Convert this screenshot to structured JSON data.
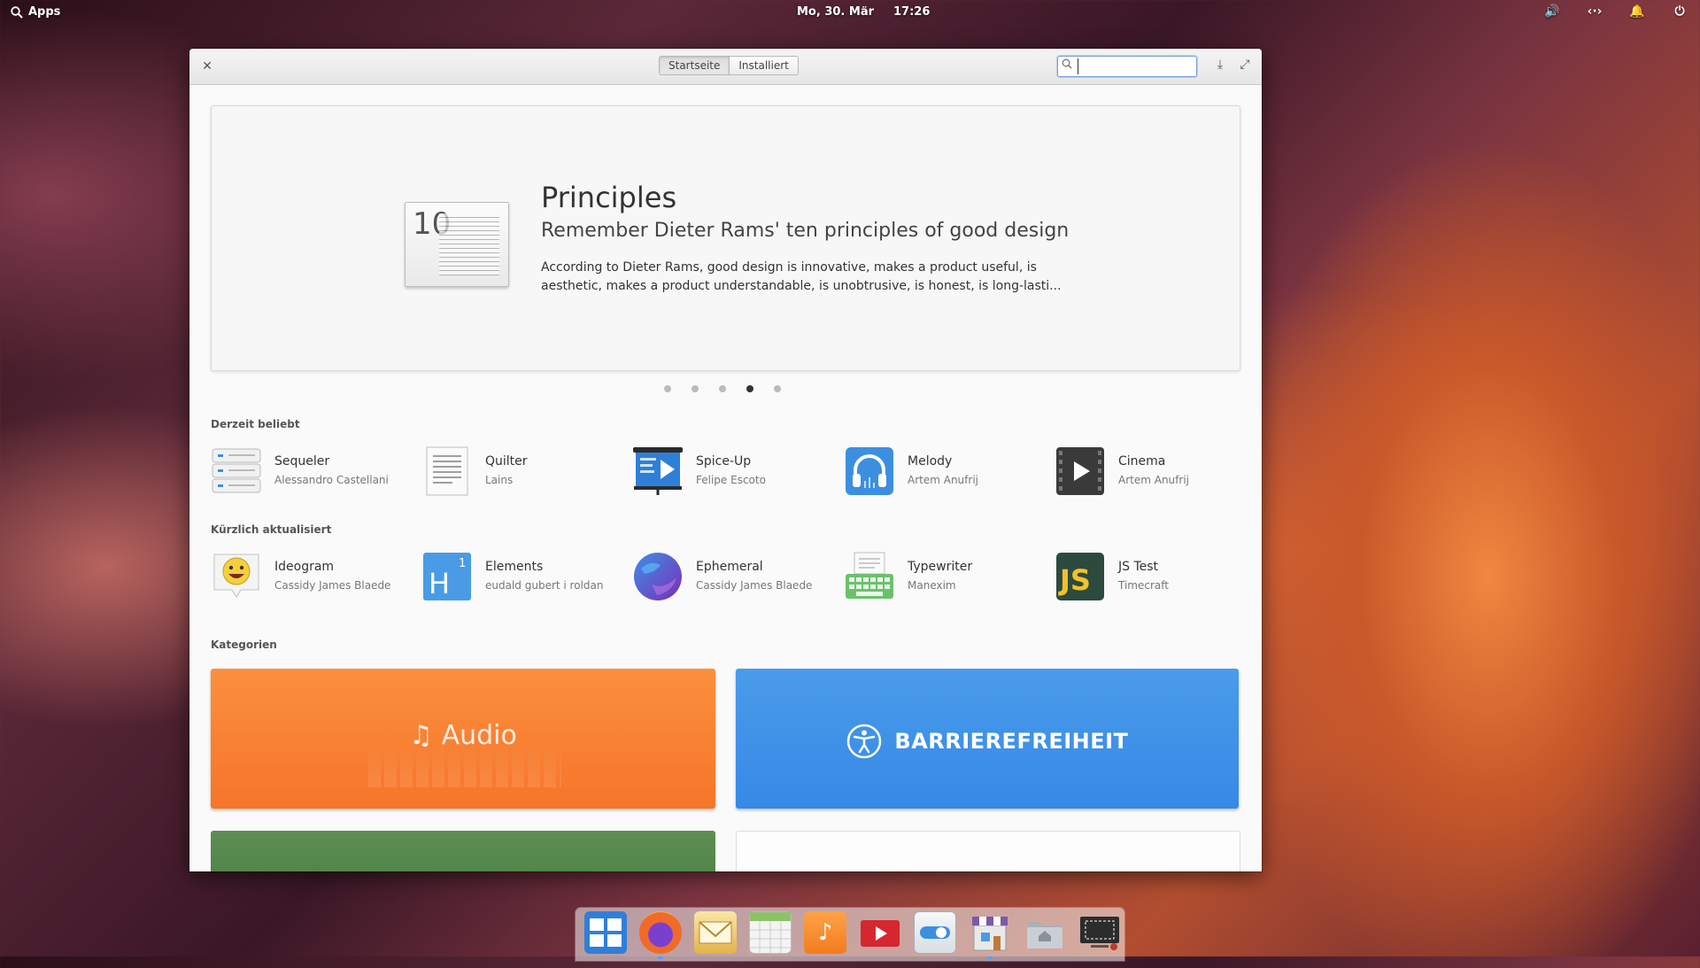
{
  "panel": {
    "apps_label": "Apps",
    "date": "Mo, 30. Mär",
    "time": "17:26"
  },
  "window": {
    "modes": [
      "Startseite",
      "Installiert"
    ],
    "active_mode": "Startseite",
    "search_value": ""
  },
  "banner": {
    "icon_number": "10",
    "title": "Principles",
    "subtitle": "Remember Dieter Rams' ten principles of good design",
    "description": "According to Dieter Rams, good design is innovative, makes a product useful, is aesthetic, makes a product understandable, is unobtrusive, is honest, is long-lasti...",
    "dots_total": 5,
    "dots_active": 4
  },
  "popular": {
    "title": "Derzeit beliebt",
    "apps": [
      {
        "name": "Sequeler",
        "author": "Alessandro Castellani",
        "icon": "database-icon"
      },
      {
        "name": "Quilter",
        "author": "Lains",
        "icon": "document-icon"
      },
      {
        "name": "Spice-Up",
        "author": "Felipe Escoto",
        "icon": "presentation-icon"
      },
      {
        "name": "Melody",
        "author": "Artem Anufrij",
        "icon": "headphones-icon"
      },
      {
        "name": "Cinema",
        "author": "Artem Anufrij",
        "icon": "video-player-icon"
      }
    ]
  },
  "recent": {
    "title": "Kürzlich aktualisiert",
    "apps": [
      {
        "name": "Ideogram",
        "author": "Cassidy James Blaede",
        "icon": "emoji-icon"
      },
      {
        "name": "Elements",
        "author": "eudald gubert i roldan",
        "icon": "heading-icon"
      },
      {
        "name": "Ephemeral",
        "author": "Cassidy James Blaede",
        "icon": "globe-icon"
      },
      {
        "name": "Typewriter",
        "author": "Manexim",
        "icon": "keyboard-icon"
      },
      {
        "name": "JS Test",
        "author": "Timecraft",
        "icon": "js-icon"
      }
    ]
  },
  "categories": {
    "title": "Kategorien",
    "audio_label": "Audio",
    "accessibility_label": "BARRIEREFREIHEIT"
  },
  "colors": {
    "accent": "#3689e6",
    "audio": "#f6752a",
    "accessibility": "#3689e6",
    "dock_running": "#4da3ff"
  },
  "dock": {
    "items": [
      {
        "icon": "multitasking-icon",
        "color": "#2f7fd8"
      },
      {
        "icon": "firefox-icon",
        "color": "#e0552a"
      },
      {
        "icon": "mail-icon",
        "color": "#e2b34a"
      },
      {
        "icon": "calendar-icon",
        "color": "#8cc26a"
      },
      {
        "icon": "music-icon",
        "color": "#f29230"
      },
      {
        "icon": "videos-icon",
        "color": "#d6262f"
      },
      {
        "icon": "settings-icon",
        "color": "#5b6b7a"
      },
      {
        "icon": "appcenter-icon",
        "color": "#7a5aa8"
      },
      {
        "icon": "files-icon",
        "color": "#9aa0a6"
      },
      {
        "icon": "screenshot-icon",
        "color": "#2c2c2c"
      }
    ]
  }
}
